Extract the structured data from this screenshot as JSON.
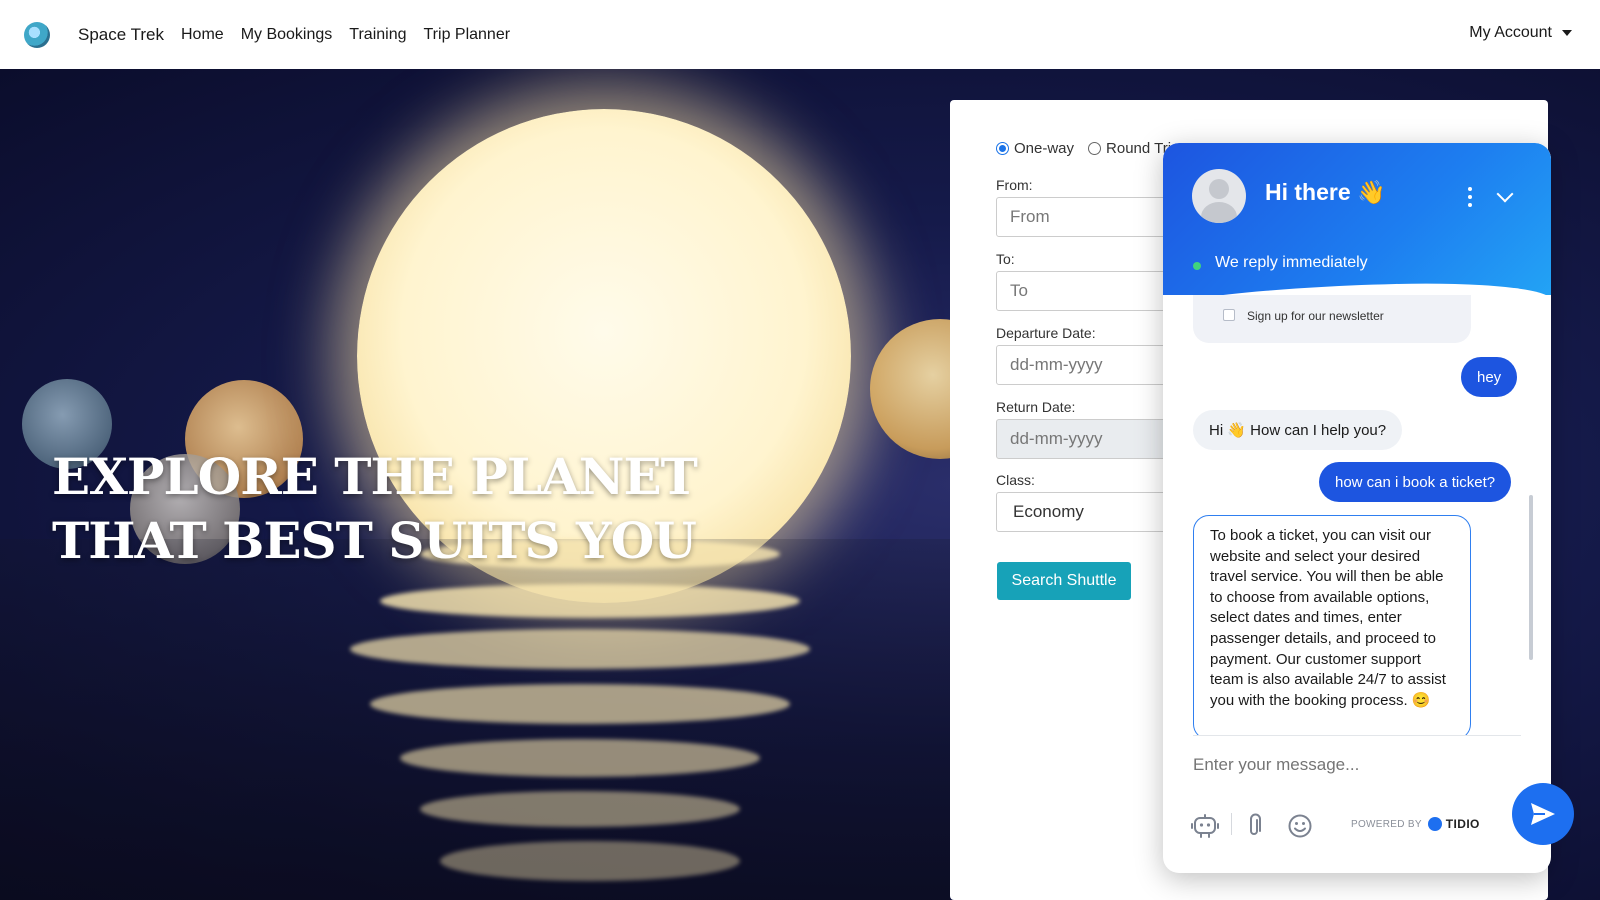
{
  "navbar": {
    "brand": "Space Trek",
    "links": [
      "Home",
      "My Bookings",
      "Training",
      "Trip Planner"
    ],
    "account": "My Account"
  },
  "hero": {
    "headline_line1": "EXPLORE THE PLANET",
    "headline_line2": "THAT BEST SUITS YOU"
  },
  "booking": {
    "trip_types": [
      "One-way",
      "Round Trip"
    ],
    "selected_trip_type": "One-way",
    "from_label": "From:",
    "from_placeholder": "From",
    "to_label": "To:",
    "to_placeholder": "To",
    "departure_label": "Departure Date:",
    "departure_placeholder": "dd-mm-yyyy",
    "return_label": "Return Date:",
    "return_placeholder": "dd-mm-yyyy",
    "class_label": "Class:",
    "class_value": "Economy",
    "search_button": "Search Shuttle"
  },
  "chat": {
    "title": "Hi there 👋",
    "status": "We reply immediately",
    "newsletter_label": "Sign up for our newsletter",
    "messages": [
      {
        "from": "user",
        "text": "hey"
      },
      {
        "from": "bot",
        "text": "Hi 👋 How can I help you?"
      },
      {
        "from": "user",
        "text": "how can i book a ticket?"
      },
      {
        "from": "bot",
        "text": "To book a ticket, you can visit our website and select your desired travel service. You will then be able to choose from available options, select dates and times, enter passenger details, and proceed to payment. Our customer support team is also available 24/7 to assist you with the booking process. 😊"
      }
    ],
    "input_placeholder": "Enter your message...",
    "powered_by": "POWERED BY",
    "provider": "TIDIO"
  },
  "colors": {
    "accent": "#17a2b8",
    "chat_primary": "#1d55e0",
    "online": "#41d37e"
  }
}
